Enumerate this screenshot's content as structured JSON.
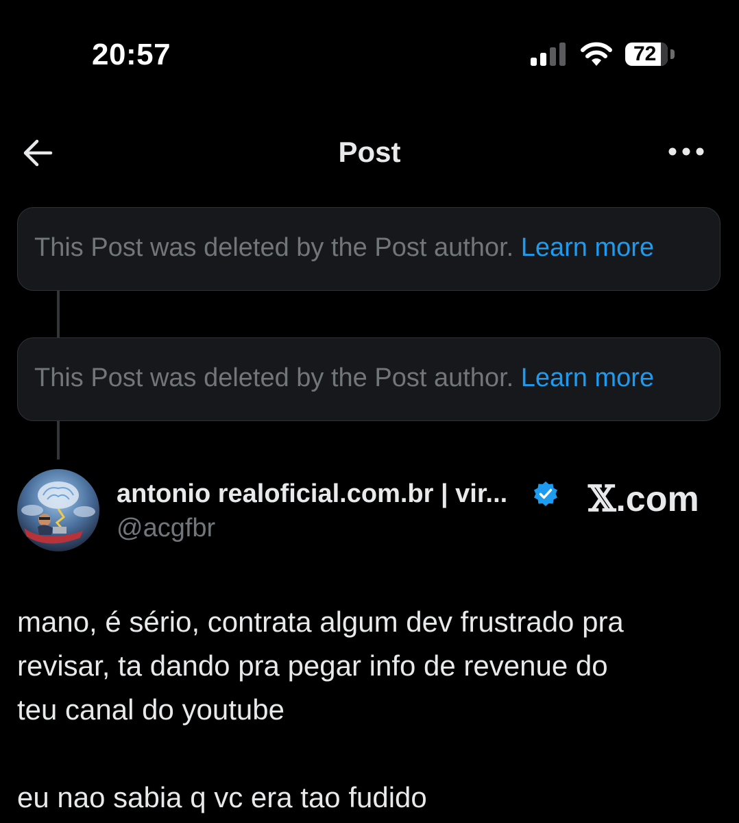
{
  "status_bar": {
    "time": "20:57",
    "battery": "72",
    "icons": [
      "cellular-signal-icon",
      "wifi-icon",
      "battery-icon"
    ]
  },
  "header": {
    "title": "Post",
    "back_icon": "arrow-left-icon",
    "more_icon": "more-horizontal-icon"
  },
  "deleted_posts": [
    {
      "message": "This Post was deleted by the Post author.",
      "link": "Learn more"
    },
    {
      "message": "This Post was deleted by the Post author.",
      "link": "Learn more"
    }
  ],
  "author": {
    "name": "antonio realoficial.com.br | vir...",
    "handle": "@acgfbr",
    "verified": true
  },
  "watermark": {
    "x": "𝕏",
    "rest": ".com"
  },
  "post": {
    "lines": [
      "mano, é sério, contrata algum dev frustrado pra",
      "revisar, ta dando pra pegar info de revenue do",
      "teu canal do youtube"
    ],
    "second_paragraph": "eu nao sabia q vc era tao fudido"
  },
  "colors": {
    "background": "#000000",
    "text": "#e7e9ea",
    "secondary": "#71767b",
    "link": "#1d9bf0",
    "card": "#16181c",
    "verified": "#1d9bf0"
  }
}
